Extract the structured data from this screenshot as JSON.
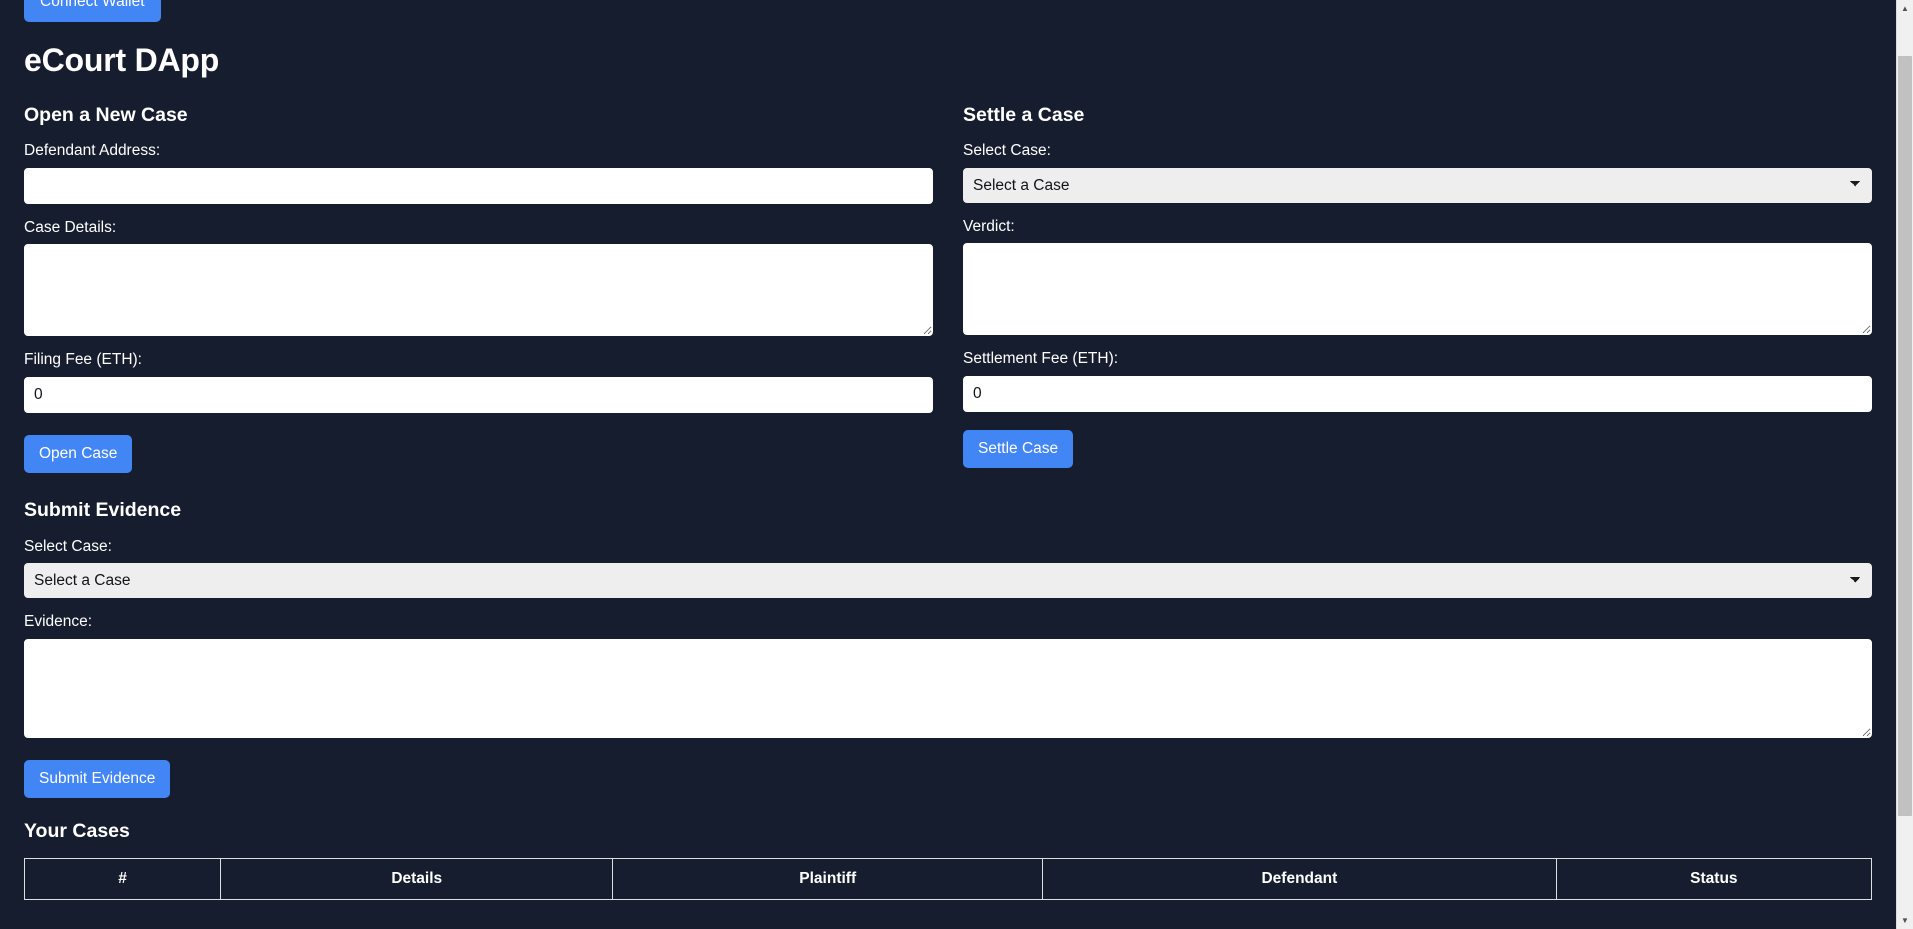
{
  "window": {
    "background_color": "#161d2e",
    "accent_color": "#4285f4"
  },
  "topbar": {
    "connect_wallet_label": "Connect Wallet"
  },
  "app": {
    "title": "eCourt DApp"
  },
  "open_case": {
    "heading": "Open a New Case",
    "defendant_address": {
      "label": "Defendant Address:",
      "value": "",
      "placeholder": ""
    },
    "case_details": {
      "label": "Case Details:",
      "value": "",
      "placeholder": ""
    },
    "filing_fee": {
      "label": "Filing Fee (ETH):",
      "value": "0",
      "placeholder": ""
    },
    "submit_label": "Open Case"
  },
  "settle_case": {
    "heading": "Settle a Case",
    "select_case": {
      "label": "Select Case:",
      "selected": "Select a Case",
      "options": [
        "Select a Case"
      ]
    },
    "verdict": {
      "label": "Verdict:",
      "value": "",
      "placeholder": ""
    },
    "settlement_fee": {
      "label": "Settlement Fee (ETH):",
      "value": "0",
      "placeholder": ""
    },
    "submit_label": "Settle Case"
  },
  "submit_evidence": {
    "heading": "Submit Evidence",
    "select_case": {
      "label": "Select Case:",
      "selected": "Select a Case",
      "options": [
        "Select a Case"
      ]
    },
    "evidence": {
      "label": "Evidence:",
      "value": "",
      "placeholder": ""
    },
    "submit_label": "Submit Evidence"
  },
  "your_cases": {
    "heading": "Your Cases",
    "columns": [
      "#",
      "Details",
      "Plaintiff",
      "Defendant",
      "Status"
    ],
    "rows": []
  },
  "icons": {
    "scroll_up": "▲",
    "scroll_down": "▼"
  }
}
